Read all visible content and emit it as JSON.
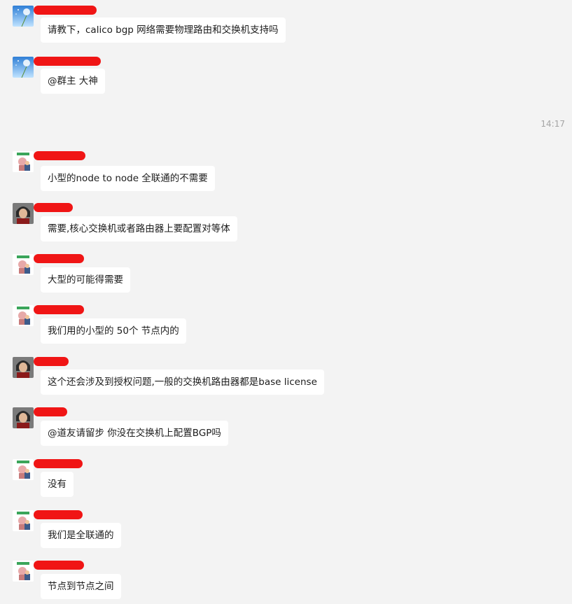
{
  "timestamp": "14:17",
  "messages": [
    {
      "avatar": "dandelion-avatar-icon",
      "text": "请教下，calico bgp 网络需要物理路由和交换机支持吗"
    },
    {
      "avatar": "dandelion-avatar-icon",
      "text": "@群主 大神"
    },
    {
      "avatar": "cartoon-couple-avatar-icon",
      "text": "小型的node to node 全联通的不需要"
    },
    {
      "avatar": "person-photo-avatar-icon",
      "text": "需要,核心交换机或者路由器上要配置对等体"
    },
    {
      "avatar": "cartoon-couple-avatar-icon",
      "text": "大型的可能得需要"
    },
    {
      "avatar": "cartoon-couple-avatar-icon",
      "text": "我们用的小型的  50个 节点内的"
    },
    {
      "avatar": "person-photo-avatar-icon",
      "text": "这个还会涉及到授权问题,一般的交换机路由器都是base license"
    },
    {
      "avatar": "person-photo-avatar-icon",
      "text": "@道友请留步 你没在交换机上配置BGP吗"
    },
    {
      "avatar": "cartoon-couple-avatar-icon",
      "text": "没有"
    },
    {
      "avatar": "cartoon-couple-avatar-icon",
      "text": "我们是全联通的"
    },
    {
      "avatar": "cartoon-couple-avatar-icon",
      "text": "节点到节点之间"
    }
  ],
  "colors": {
    "background": "#f3f3f3",
    "bubble": "#ffffff",
    "redaction": "#f01515",
    "timestamp": "#a4a4a4"
  }
}
